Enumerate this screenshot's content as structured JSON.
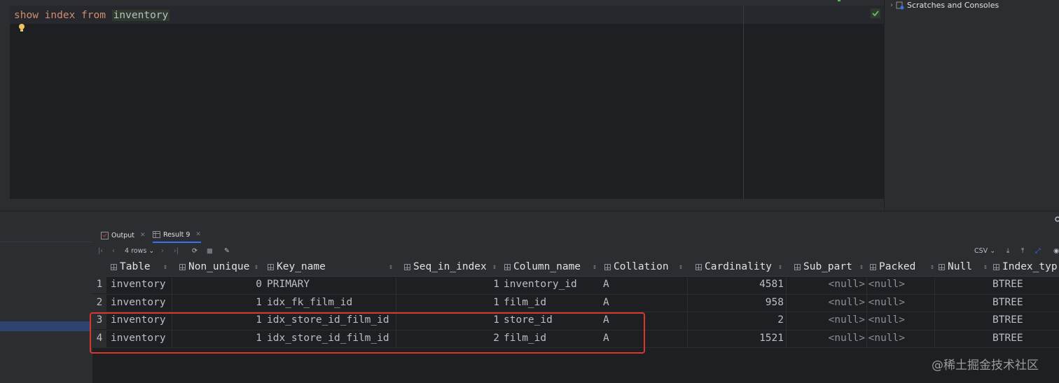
{
  "editor": {
    "sql_keywords": [
      "show",
      "index",
      "from"
    ],
    "sql_table": "inventory"
  },
  "project_panel": {
    "scratches_label": "Scratches and Consoles"
  },
  "tabs": [
    {
      "label": "Output",
      "icon": "output-icon"
    },
    {
      "label": "Result 9",
      "icon": "table-icon"
    }
  ],
  "toolbar": {
    "rows_label": "4 rows",
    "export_format": "CSV"
  },
  "grid": {
    "columns": [
      "Table",
      "Non_unique",
      "Key_name",
      "Seq_in_index",
      "Column_name",
      "Collation",
      "Cardinality",
      "Sub_part",
      "Packed",
      "Null",
      "Index_typ"
    ],
    "rows": [
      {
        "n": "1",
        "Table": "inventory",
        "Non_unique": "0",
        "Key_name": "PRIMARY",
        "Seq_in_index": "1",
        "Column_name": "inventory_id",
        "Collation": "A",
        "Cardinality": "4581",
        "Sub_part": "<null>",
        "Packed": "<null>",
        "Null": "",
        "Index_type": "BTREE"
      },
      {
        "n": "2",
        "Table": "inventory",
        "Non_unique": "1",
        "Key_name": "idx_fk_film_id",
        "Seq_in_index": "1",
        "Column_name": "film_id",
        "Collation": "A",
        "Cardinality": "958",
        "Sub_part": "<null>",
        "Packed": "<null>",
        "Null": "",
        "Index_type": "BTREE"
      },
      {
        "n": "3",
        "Table": "inventory",
        "Non_unique": "1",
        "Key_name": "idx_store_id_film_id",
        "Seq_in_index": "1",
        "Column_name": "store_id",
        "Collation": "A",
        "Cardinality": "2",
        "Sub_part": "<null>",
        "Packed": "<null>",
        "Null": "",
        "Index_type": "BTREE"
      },
      {
        "n": "4",
        "Table": "inventory",
        "Non_unique": "1",
        "Key_name": "idx_store_id_film_id",
        "Seq_in_index": "2",
        "Column_name": "film_id",
        "Collation": "A",
        "Cardinality": "1521",
        "Sub_part": "<null>",
        "Packed": "<null>",
        "Null": "",
        "Index_type": "BTREE"
      }
    ]
  },
  "watermark": "@稀土掘金技术社区",
  "colors": {
    "keyword": "#cf8e6d",
    "highlight_border": "#d8382f",
    "editor_bg": "#1e1f22",
    "panel_bg": "#2b2d30"
  }
}
